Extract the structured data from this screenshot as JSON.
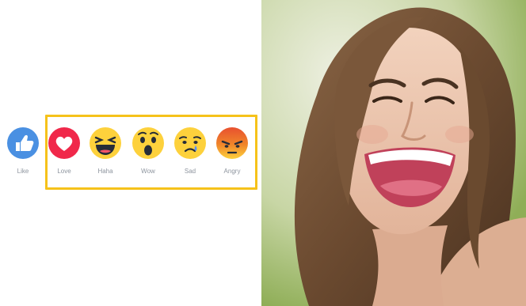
{
  "reactions": [
    {
      "key": "like",
      "label": "Like",
      "icon": "thumbs-up-icon",
      "color": "#4a90e2"
    },
    {
      "key": "love",
      "label": "Love",
      "icon": "heart-icon",
      "color": "#f0284a"
    },
    {
      "key": "haha",
      "label": "Haha",
      "icon": "laughing-face-icon",
      "color": "#fdd13c"
    },
    {
      "key": "wow",
      "label": "Wow",
      "icon": "surprised-face-icon",
      "color": "#fdd13c"
    },
    {
      "key": "sad",
      "label": "Sad",
      "icon": "sad-face-icon",
      "color": "#fdd13c"
    },
    {
      "key": "angry",
      "label": "Angry",
      "icon": "angry-face-icon",
      "color": "#e8502f"
    }
  ],
  "highlight_color": "#f6c21a",
  "photo": {
    "icon": "laughing-woman-photo"
  }
}
